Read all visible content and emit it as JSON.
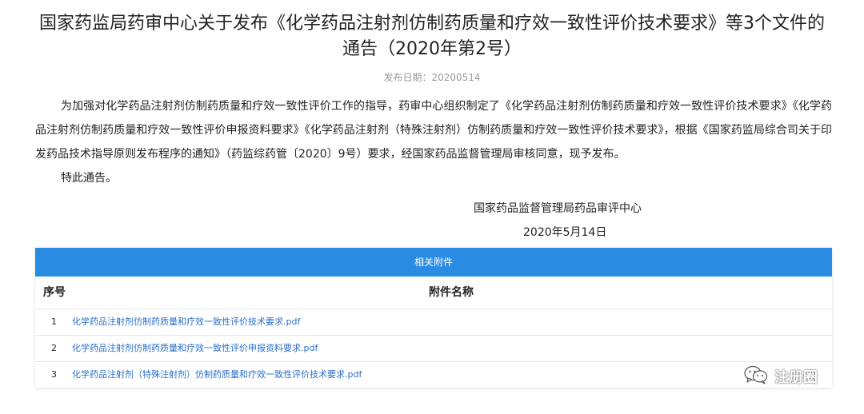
{
  "notice": {
    "title": "国家药监局药审中心关于发布《化学药品注射剂仿制药质量和疗效一致性评价技术要求》等3个文件的通告（2020年第2号）",
    "date_label": "发布日期：20200514",
    "paragraph1": "为加强对化学药品注射剂仿制药质量和疗效一致性评价工作的指导，药审中心组织制定了《化学药品注射剂仿制药质量和疗效一致性评价技术要求》《化学药品注射剂仿制药质量和疗效一致性评价申报资料要求》《化学药品注射剂（特殊注射剂）仿制药质量和疗效一致性评价技术要求》，根据《国家药监局综合司关于印发药品技术指导原则发布程序的通知》（药监综药管〔2020〕9号）要求，经国家药品监督管理局审核同意，现予发布。",
    "paragraph2": "特此通告。",
    "signature_org": "国家药品监督管理局药品审评中心",
    "signature_date": "2020年5月14日"
  },
  "attachments": {
    "header": "相关附件",
    "col_seq": "序号",
    "col_name": "附件名称",
    "rows": [
      {
        "num": "1",
        "name": "化学药品注射剂仿制药质量和疗效一致性评价技术要求.pdf"
      },
      {
        "num": "2",
        "name": "化学药品注射剂仿制药质量和疗效一致性评价申报资料要求.pdf"
      },
      {
        "num": "3",
        "name": "化学药品注射剂（特殊注射剂）仿制药质量和疗效一致性评价技术要求.pdf"
      }
    ]
  },
  "watermark": {
    "icon": "wechat-icon",
    "text": "注册圈"
  },
  "colors": {
    "header_blue": "#2a8be3",
    "link_blue": "#2a6fc9"
  }
}
